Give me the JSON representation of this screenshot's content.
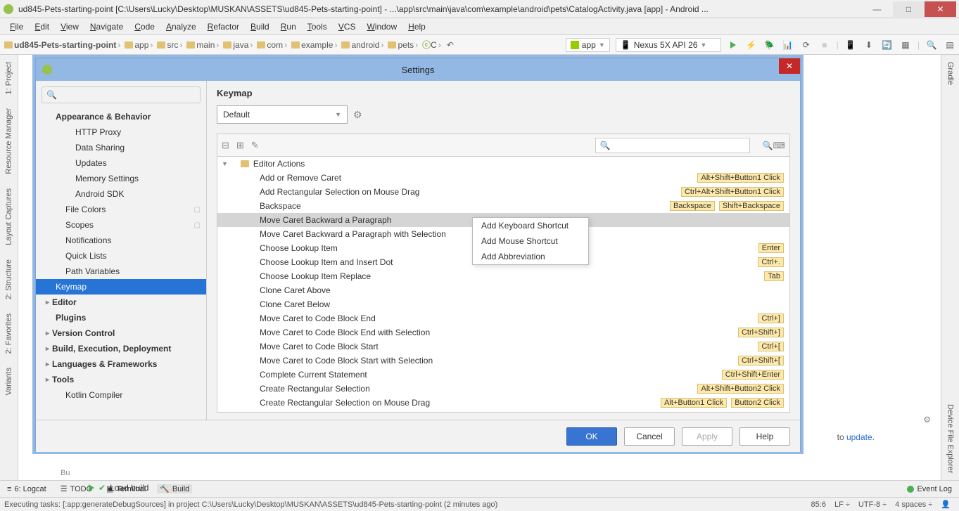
{
  "window": {
    "title": "ud845-Pets-starting-point [C:\\Users\\Lucky\\Desktop\\MUSKAN\\ASSETS\\ud845-Pets-starting-point] - ...\\app\\src\\main\\java\\com\\example\\android\\pets\\CatalogActivity.java [app] - Android ..."
  },
  "menu": [
    "File",
    "Edit",
    "View",
    "Navigate",
    "Code",
    "Analyze",
    "Refactor",
    "Build",
    "Run",
    "Tools",
    "VCS",
    "Window",
    "Help"
  ],
  "breadcrumbs": [
    "ud845-Pets-starting-point",
    "app",
    "src",
    "main",
    "java",
    "com",
    "example",
    "android",
    "pets",
    "C"
  ],
  "run_config": "app",
  "device_sel": "Nexus 5X API 26",
  "side_left": [
    "1: Project",
    "Resource Manager",
    "Layout Captures",
    "2: Structure",
    "2: Favorites",
    "Variants"
  ],
  "side_right": [
    "Gradle",
    "Device File Explorer"
  ],
  "bottom_tabs": {
    "logcat": "6: Logcat",
    "todo": "TODO",
    "terminal": "Terminal",
    "build": "Build",
    "event": "Event Log"
  },
  "status": {
    "text": "Executing tasks: [:app:generateDebugSources] in project C:\\Users\\Lucky\\Desktop\\MUSKAN\\ASSETS\\ud845-Pets-starting-point (2 minutes ago)",
    "pos": "85:6",
    "lf": "LF",
    "enc": "UTF-8",
    "indent": "4 spaces"
  },
  "sync": {
    "tail": " to ",
    "link": "update",
    "after": "."
  },
  "load_build": "Load build",
  "dialog": {
    "title": "Settings",
    "nav": {
      "appearance": "Appearance & Behavior",
      "http": "HTTP Proxy",
      "data_sharing": "Data Sharing",
      "updates": "Updates",
      "memory": "Memory Settings",
      "sdk": "Android SDK",
      "file_colors": "File Colors",
      "scopes": "Scopes",
      "notifications": "Notifications",
      "quick": "Quick Lists",
      "path": "Path Variables",
      "keymap": "Keymap",
      "editor": "Editor",
      "plugins": "Plugins",
      "vc": "Version Control",
      "build": "Build, Execution, Deployment",
      "lang": "Languages & Frameworks",
      "tools": "Tools",
      "kotlin": "Kotlin Compiler"
    },
    "content": {
      "title": "Keymap",
      "scheme": "Default",
      "tree_root": "Editor Actions",
      "actions": [
        {
          "label": "Add or Remove Caret",
          "sc": [
            "Alt+Shift+Button1 Click"
          ]
        },
        {
          "label": "Add Rectangular Selection on Mouse Drag",
          "sc": [
            "Ctrl+Alt+Shift+Button1 Click"
          ]
        },
        {
          "label": "Backspace",
          "sc": [
            "Backspace",
            "Shift+Backspace"
          ]
        },
        {
          "label": "Move Caret Backward a Paragraph",
          "sc": [],
          "selected": true
        },
        {
          "label": "Move Caret Backward a Paragraph with Selection",
          "sc": []
        },
        {
          "label": "Choose Lookup Item",
          "sc": [
            "Enter"
          ]
        },
        {
          "label": "Choose Lookup Item and Insert Dot",
          "sc": [
            "Ctrl+."
          ]
        },
        {
          "label": "Choose Lookup Item Replace",
          "sc": [
            "Tab"
          ]
        },
        {
          "label": "Clone Caret Above",
          "sc": []
        },
        {
          "label": "Clone Caret Below",
          "sc": []
        },
        {
          "label": "Move Caret to Code Block End",
          "sc": [
            "Ctrl+]"
          ]
        },
        {
          "label": "Move Caret to Code Block End with Selection",
          "sc": [
            "Ctrl+Shift+]"
          ]
        },
        {
          "label": "Move Caret to Code Block Start",
          "sc": [
            "Ctrl+["
          ]
        },
        {
          "label": "Move Caret to Code Block Start with Selection",
          "sc": [
            "Ctrl+Shift+["
          ]
        },
        {
          "label": "Complete Current Statement",
          "sc": [
            "Ctrl+Shift+Enter"
          ]
        },
        {
          "label": "Create Rectangular Selection",
          "sc": [
            "Alt+Shift+Button2 Click"
          ]
        },
        {
          "label": "Create Rectangular Selection on Mouse Drag",
          "sc": [
            "Alt+Button1 Click",
            "Button2 Click"
          ]
        }
      ],
      "ctx": [
        "Add Keyboard Shortcut",
        "Add Mouse Shortcut",
        "Add Abbreviation"
      ]
    },
    "buttons": {
      "ok": "OK",
      "cancel": "Cancel",
      "apply": "Apply",
      "help": "Help"
    }
  }
}
